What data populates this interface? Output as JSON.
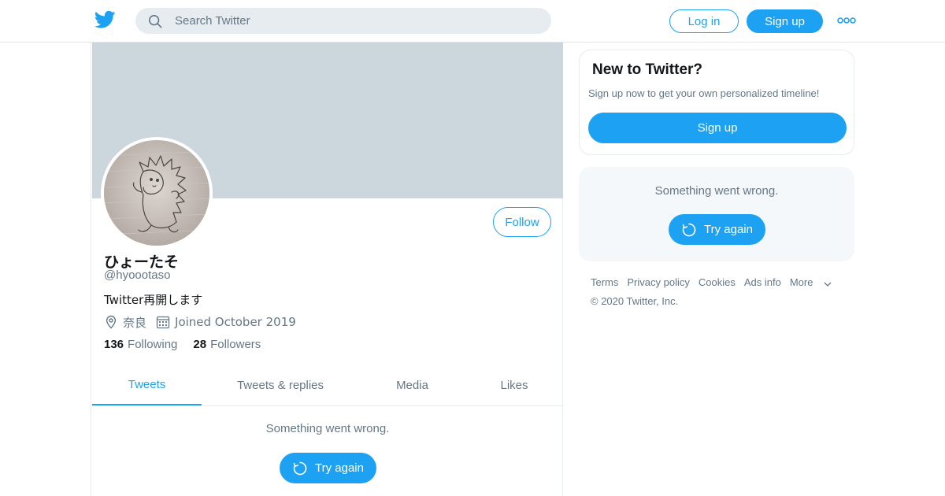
{
  "header": {
    "search_placeholder": "Search Twitter",
    "login_label": "Log in",
    "signup_label": "Sign up"
  },
  "profile": {
    "display_name": "ひょーたそ",
    "handle": "@hyoootaso",
    "bio": "Twitter再開します",
    "location": "奈良",
    "joined": "Joined October 2019",
    "following_count": "136",
    "following_label": "Following",
    "followers_count": "28",
    "followers_label": "Followers",
    "follow_label": "Follow"
  },
  "tabs": [
    {
      "label": "Tweets",
      "active": true
    },
    {
      "label": "Tweets & replies",
      "active": false
    },
    {
      "label": "Media",
      "active": false
    },
    {
      "label": "Likes",
      "active": false
    }
  ],
  "timeline": {
    "error_text": "Something went wrong.",
    "retry_label": "Try again"
  },
  "sidebar": {
    "signup_card": {
      "heading": "New to Twitter?",
      "text": "Sign up now to get your own personalized timeline!",
      "button_label": "Sign up"
    },
    "error_card": {
      "text": "Something went wrong.",
      "retry_label": "Try again"
    }
  },
  "footer": {
    "links": [
      "Terms",
      "Privacy policy",
      "Cookies",
      "Ads info",
      "More"
    ],
    "copyright": "© 2020 Twitter, Inc."
  },
  "colors": {
    "accent": "#1da1f2",
    "banner": "#ccd6dd",
    "secondary_text": "#657786",
    "primary_text": "#14171a"
  },
  "icons": [
    "twitter-bird-icon",
    "search-icon",
    "more-dots-icon",
    "location-pin-icon",
    "calendar-icon",
    "refresh-icon",
    "chevron-down-icon"
  ]
}
